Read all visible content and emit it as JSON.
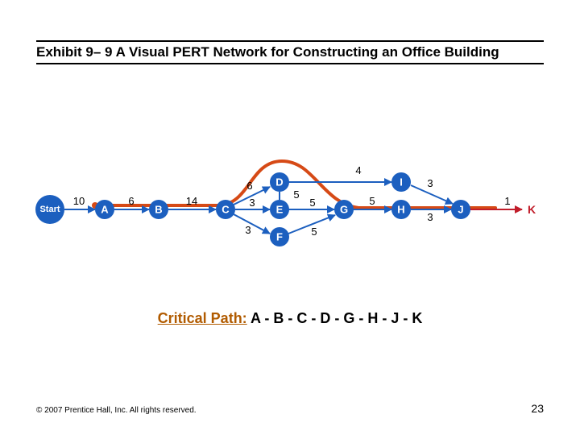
{
  "header": {
    "title": "Exhibit 9– 9   A Visual PERT Network for Constructing an Office Building"
  },
  "critical": {
    "lead": "Critical Path:",
    "path": " A - B - C - D - G - H - J - K"
  },
  "footer": {
    "copyright": "© 2007 Prentice Hall, Inc. All rights reserved.",
    "page": "23"
  },
  "nodes": {
    "Start": "Start",
    "A": "A",
    "B": "B",
    "C": "C",
    "D": "D",
    "E": "E",
    "F": "F",
    "G": "G",
    "H": "H",
    "I": "I",
    "J": "J",
    "K": "K"
  },
  "edges": {
    "Start_A": "10",
    "A_B": "6",
    "B_C": "14",
    "C_D": "6",
    "C_E": "3",
    "C_F": "3",
    "D_E": "5",
    "D_I": "4",
    "E_G": "5",
    "F_G": "5",
    "G_H": "5",
    "H_J": "3",
    "I_J": "3",
    "J_K": "1"
  },
  "chart_data": {
    "type": "network",
    "title": "A Visual PERT Network for Constructing an Office Building",
    "nodes": [
      "Start",
      "A",
      "B",
      "C",
      "D",
      "E",
      "F",
      "G",
      "H",
      "I",
      "J",
      "K"
    ],
    "edges": [
      {
        "from": "Start",
        "to": "A",
        "weight": 10
      },
      {
        "from": "A",
        "to": "B",
        "weight": 6
      },
      {
        "from": "B",
        "to": "C",
        "weight": 14
      },
      {
        "from": "C",
        "to": "D",
        "weight": 6
      },
      {
        "from": "C",
        "to": "E",
        "weight": 3
      },
      {
        "from": "C",
        "to": "F",
        "weight": 3
      },
      {
        "from": "D",
        "to": "E",
        "weight": 5
      },
      {
        "from": "D",
        "to": "I",
        "weight": 4
      },
      {
        "from": "E",
        "to": "G",
        "weight": 5
      },
      {
        "from": "F",
        "to": "G",
        "weight": 5
      },
      {
        "from": "G",
        "to": "H",
        "weight": 5
      },
      {
        "from": "H",
        "to": "J",
        "weight": 3
      },
      {
        "from": "I",
        "to": "J",
        "weight": 3
      },
      {
        "from": "J",
        "to": "K",
        "weight": 1
      }
    ],
    "critical_path": [
      "A",
      "B",
      "C",
      "D",
      "G",
      "H",
      "J",
      "K"
    ]
  }
}
